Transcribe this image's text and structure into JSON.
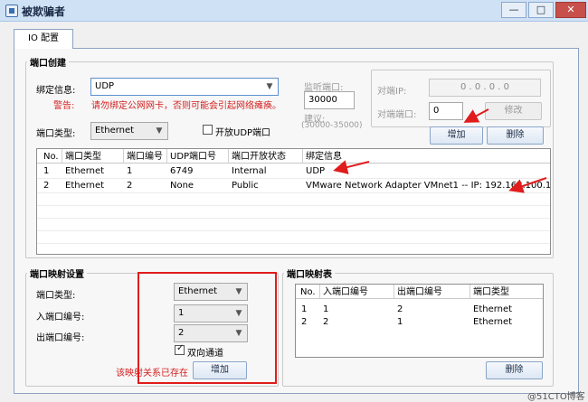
{
  "window": {
    "title": "被欺骗者",
    "minimize": "—",
    "maximize": "□",
    "close": "✕"
  },
  "tab": {
    "label": "IO 配置"
  },
  "port_create": {
    "group_title": "端口创建",
    "bind_label": "绑定信息:",
    "bind_value": "UDP",
    "warn_label": "警告:",
    "warn_text": "请勿绑定公网网卡，否则可能会引起网络瘫痪。",
    "port_type_label": "端口类型:",
    "port_type_value": "Ethernet",
    "open_udp_label": "开放UDP端口",
    "listen_label": "监听端口:",
    "listen_value": "30000",
    "suggest_label": "建议:",
    "suggest_range": "(30000-35000)",
    "peer_ip_label": "对端IP:",
    "peer_ip_value": "0 . 0 . 0 . 0",
    "peer_port_label": "对端端口:",
    "peer_port_value": "0",
    "modify_button": "修改",
    "add_button": "增加",
    "delete_button": "删除",
    "table": {
      "headers": [
        "No.",
        "端口类型",
        "端口编号",
        "UDP端口号",
        "端口开放状态",
        "绑定信息"
      ],
      "rows": [
        [
          "1",
          "Ethernet",
          "1",
          "6749",
          "Internal",
          "UDP"
        ],
        [
          "2",
          "Ethernet",
          "2",
          "None",
          "Public",
          "VMware Network Adapter VMnet1 -- IP: 192.168.100.1"
        ]
      ]
    }
  },
  "mapping_settings": {
    "group_title": "端口映射设置",
    "port_type_label": "端口类型:",
    "port_type_value": "Ethernet",
    "in_port_label": "入端口编号:",
    "in_port_value": "1",
    "out_port_label": "出端口编号:",
    "out_port_value": "2",
    "bidirectional_label": "双向通道",
    "exists_text": "该映射关系已存在",
    "add_button": "增加"
  },
  "mapping_table": {
    "group_title": "端口映射表",
    "headers": [
      "No.",
      "入端口编号",
      "出端口编号",
      "端口类型"
    ],
    "rows": [
      [
        "1",
        "1",
        "2",
        "Ethernet"
      ],
      [
        "2",
        "2",
        "1",
        "Ethernet"
      ]
    ],
    "delete_button": "删除"
  },
  "watermark": "@51CTO博客",
  "colors": {
    "annotation_red": "#e01c1c",
    "warning_red": "#d42020"
  }
}
